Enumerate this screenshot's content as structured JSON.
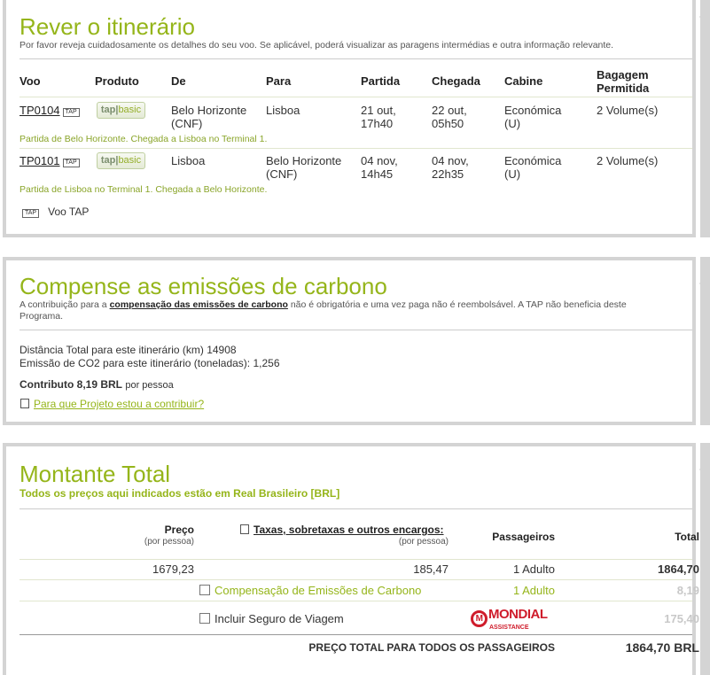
{
  "itinerary": {
    "title": "Rever o itinerário",
    "intro": "Por favor reveja cuidadosamente os detalhes do seu voo. Se aplicável, poderá visualizar as paragens intermédias e outra informação relevante.",
    "headers": [
      "Voo",
      "Produto",
      "De",
      "Para",
      "Partida",
      "Chegada",
      "Cabine",
      "Bagagem Permitida"
    ],
    "flights": [
      {
        "number": "TP0104",
        "badge": "TAP",
        "product_brand": "tap",
        "product_tier": "basic",
        "from": "Belo Horizonte (CNF)",
        "to": "Lisboa",
        "departure": "21 out, 17h40",
        "arrival": "22 out, 05h50",
        "cabin": "Económica (U)",
        "baggage": "2 Volume(s)",
        "note": "Partida de Belo Horizonte. Chegada a Lisboa no Terminal 1."
      },
      {
        "number": "TP0101",
        "badge": "TAP",
        "product_brand": "tap",
        "product_tier": "basic",
        "from": "Lisboa",
        "to": "Belo Horizonte (CNF)",
        "departure": "04 nov, 14h45",
        "arrival": "04 nov, 22h35",
        "cabin": "Económica (U)",
        "baggage": "2 Volume(s)",
        "note": "Partida de Lisboa no Terminal 1. Chegada a Belo Horizonte."
      }
    ],
    "legend_badge": "TAP",
    "legend_label": "Voo TAP"
  },
  "carbon": {
    "title": "Compense as emissões de carbono",
    "intro_before": "A contribuição para a ",
    "intro_link": "compensação das emissões de carbono",
    "intro_after": " não é obrigatória e uma vez paga não é reembolsável. A TAP não beneficia deste Programa.",
    "distance_line": "Distância Total para este itinerário (km) 14908",
    "emission_line": "Emissão de CO2 para este itinerário (toneladas): 1,256",
    "contribution": "Contributo 8,19 BRL",
    "contribution_suffix": "por pessoa",
    "project_link": "Para que Projeto estou a contribuir?"
  },
  "total": {
    "title": "Montante Total",
    "subtitle": "Todos os preços aqui indicados estão em Real Brasileiro [BRL]",
    "col_price": "Preço",
    "col_price_sub": "(por pessoa)",
    "col_taxes": "Taxas, sobretaxas e outros encargos:",
    "col_taxes_sub": "(por pessoa)",
    "col_passengers": "Passageiros",
    "col_total": "Total",
    "row_price": "1679,23",
    "row_taxes": "185,47",
    "row_passengers": "1 Adulto",
    "row_total": "1864,70",
    "carbon_label": "Compensação de Emissões de Carbono",
    "carbon_passengers": "1 Adulto",
    "carbon_total": "8,19",
    "insurance_label": "Incluir Seguro de Viagem",
    "insurance_brand": "MONDIAL",
    "insurance_brand_sub": "ASSISTANCE",
    "insurance_total": "175,40",
    "grand_label": "PREÇO TOTAL PARA TODOS OS PASSAGEIROS",
    "grand_total": "1864,70 BRL"
  },
  "colors": {
    "accent_green": "#95b51a",
    "frame_grey": "#d4d4d4",
    "brand_red": "#cf1c2b"
  }
}
